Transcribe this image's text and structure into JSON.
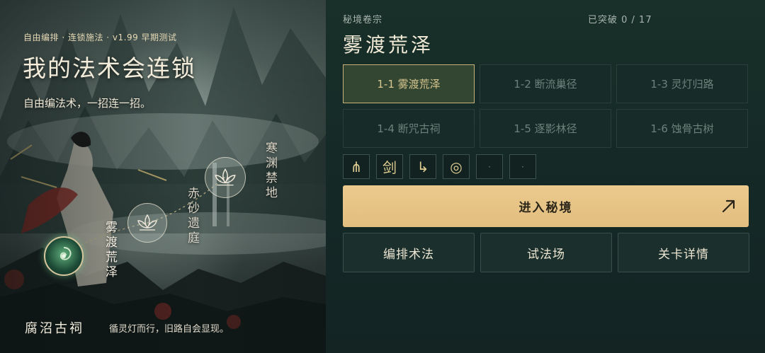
{
  "art": {
    "tagline": "自由编排 · 连锁施法 · v1.99 早期测试",
    "title": "我的法术会连锁",
    "subtitle": "自由编法术，一招连一招。",
    "map_nodes": [
      {
        "label": "雾渡荒泽",
        "state": "selected"
      },
      {
        "label": "赤砂遗庭",
        "state": "locked"
      },
      {
        "label": "寒渊禁地",
        "state": "locked"
      }
    ],
    "location_name": "腐沼古祠",
    "location_desc": "循灵灯而行，旧路自会显现。"
  },
  "panel": {
    "section_label": "秘境卷宗",
    "progress": "已突破 0 / 17",
    "title": "雾渡荒泽",
    "stages": [
      {
        "label": "1-1 雾渡荒泽",
        "active": true
      },
      {
        "label": "1-2 断流巢径",
        "active": false
      },
      {
        "label": "1-3 灵灯归路",
        "active": false
      },
      {
        "label": "1-4 断咒古祠",
        "active": false
      },
      {
        "label": "1-5 逐影林径",
        "active": false
      },
      {
        "label": "1-6 蚀骨古树",
        "active": false
      }
    ],
    "spells": [
      {
        "icon": "trident-icon",
        "glyph": "⋔"
      },
      {
        "icon": "sword-icon",
        "glyph": "剑"
      },
      {
        "icon": "redirect-arrow-icon",
        "glyph": "↳"
      },
      {
        "icon": "ring-icon",
        "glyph": "◎"
      },
      {
        "icon": "empty-slot-icon",
        "glyph": "·"
      },
      {
        "icon": "empty-slot-icon",
        "glyph": "·"
      }
    ],
    "enter_label": "进入秘境",
    "actions": [
      "编排术法",
      "试法场",
      "关卡详情"
    ]
  },
  "colors": {
    "accent_gold": "#e8c689",
    "panel_bg": "#152523",
    "active_stage_border": "#c9b27a"
  }
}
